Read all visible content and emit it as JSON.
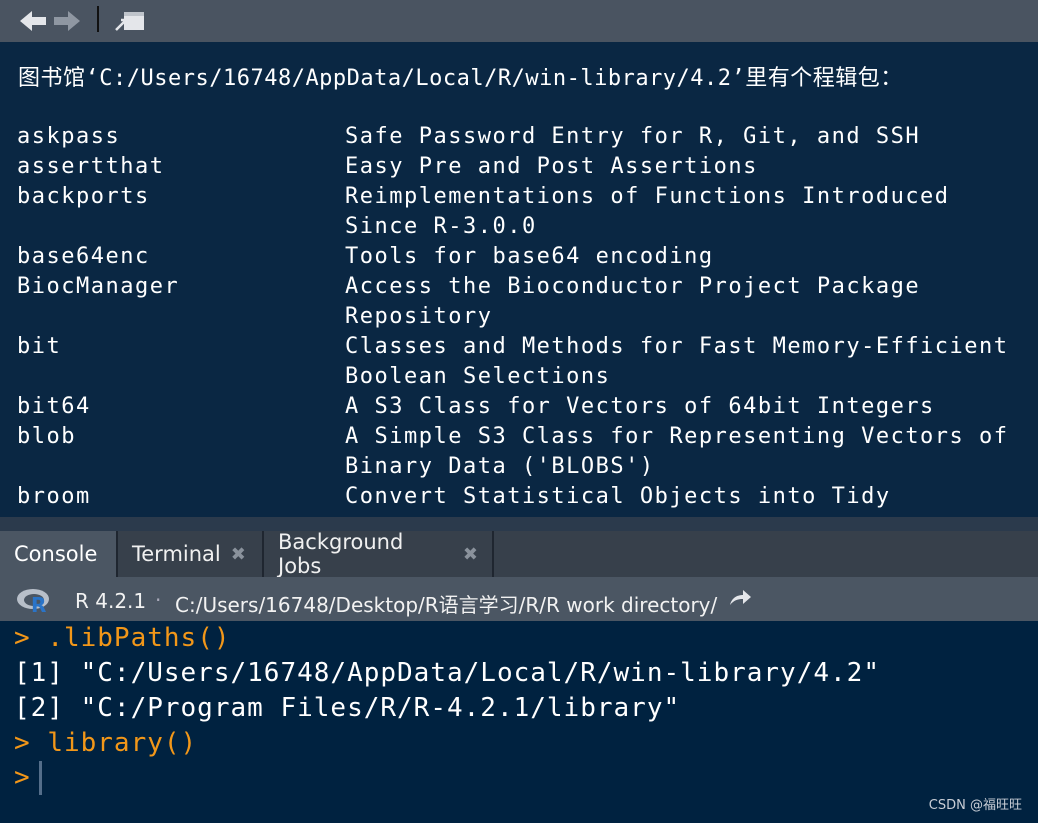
{
  "viewer": {
    "header_prefix": "图书馆",
    "header_path": "‘C:/Users/16748/AppData/Local/R/win-library/4.2’",
    "header_suffix": "里有个程辑包：",
    "packages": [
      {
        "name": "askpass",
        "desc": "Safe Password Entry for R, Git, and SSH"
      },
      {
        "name": "assertthat",
        "desc": "Easy Pre and Post Assertions"
      },
      {
        "name": "backports",
        "desc": "Reimplementations of Functions Introduced Since R-3.0.0"
      },
      {
        "name": "base64enc",
        "desc": "Tools for base64 encoding"
      },
      {
        "name": "BiocManager",
        "desc": "Access the Bioconductor Project Package Repository"
      },
      {
        "name": "bit",
        "desc": "Classes and Methods for Fast Memory-Efficient Boolean Selections"
      },
      {
        "name": "bit64",
        "desc": "A S3 Class for Vectors of 64bit Integers"
      },
      {
        "name": "blob",
        "desc": "A Simple S3 Class for Representing Vectors of Binary Data ('BLOBS')"
      },
      {
        "name": "broom",
        "desc": "Convert Statistical Objects into Tidy"
      }
    ]
  },
  "tabs": {
    "console": "Console",
    "terminal": "Terminal",
    "jobs": "Background Jobs"
  },
  "infobar": {
    "r_version": "R 4.2.1",
    "separator": "·",
    "working_dir": "C:/Users/16748/Desktop/R语言学习/R/R work directory/"
  },
  "console": {
    "prompt": ">",
    "line1_cmd": ".libPaths()",
    "line2": "[1] \"C:/Users/16748/AppData/Local/R/win-library/4.2\"",
    "line3": "[2] \"C:/Program Files/R/R-4.2.1/library\"",
    "line4_cmd": "library()"
  },
  "watermark": "CSDN @福旺旺",
  "colors": {
    "background": "#002240",
    "prompt": "#f29719",
    "toolbar": "#4a5461"
  }
}
